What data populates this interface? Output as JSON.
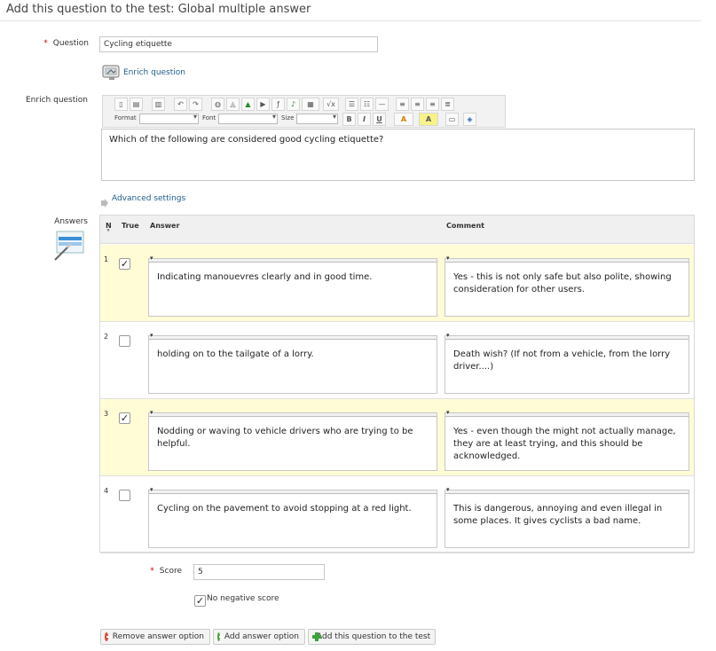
{
  "page_title": "Add this question to the test: Global multiple answer",
  "question": {
    "label": "Question",
    "value": "Cycling etiquette"
  },
  "enrich_link": "Enrich question",
  "enrich_label": "Enrich question",
  "editor": {
    "toolbar_labels": {
      "format": "Format",
      "font": "Font",
      "size": "Size",
      "bold": "B",
      "italic": "I",
      "underline": "U",
      "text_color": "A",
      "bg_color": "A"
    },
    "content": "Which of the following are considered good cycling etiquette?"
  },
  "advanced_settings": "Advanced settings",
  "answers": {
    "label": "Answers",
    "columns": {
      "n": "N",
      "n_sort": "°",
      "true": "True",
      "answer": "Answer",
      "comment": "Comment"
    },
    "rows": [
      {
        "n": "1",
        "checked": true,
        "answer": "Indicating manouevres clearly and in good time.",
        "comment": "Yes - this is not only safe but also polite, showing consideration for other users."
      },
      {
        "n": "2",
        "checked": false,
        "answer": "holding on to the tailgate of a lorry.",
        "comment": "Death wish? (If not from a vehicle, from the lorry driver....)"
      },
      {
        "n": "3",
        "checked": true,
        "answer": "Nodding or waving to vehicle drivers who are trying to be helpful.",
        "comment": "Yes - even though the might not actually manage, they are at least trying, and this should be acknowledged."
      },
      {
        "n": "4",
        "checked": false,
        "answer": "Cycling on the pavement to avoid stopping at a red light.",
        "comment": "This is dangerous, annoying and even illegal in some places. It gives cyclists a bad name."
      }
    ]
  },
  "score": {
    "label": "Score",
    "value": "5"
  },
  "no_negative_score": {
    "label": "No negative score",
    "checked": true
  },
  "buttons": {
    "remove": "Remove answer option",
    "add": "Add answer option",
    "submit": "Add this question to the test"
  },
  "colors": {
    "highlight_row": "#fffcd6",
    "link": "#1f5b8a",
    "required": "#cc0000"
  }
}
